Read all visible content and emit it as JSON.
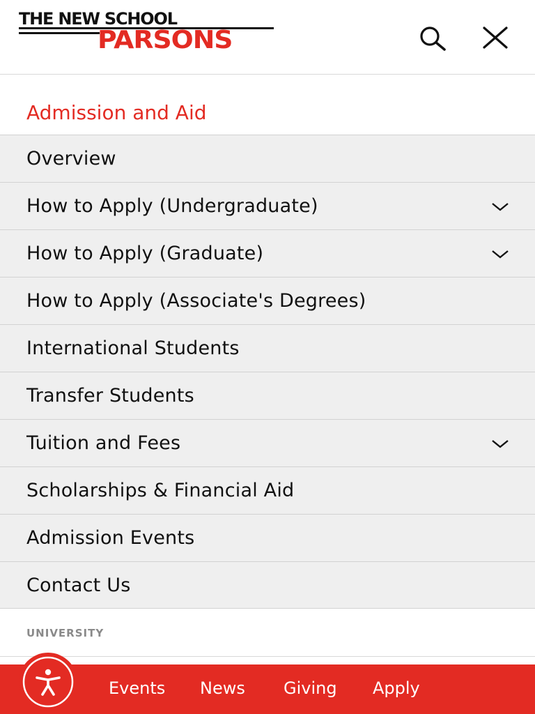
{
  "header": {
    "logo_top": "THE NEW SCHOOL",
    "logo_bottom": "PARSONS",
    "search_icon": "search-icon",
    "close_icon": "close-icon"
  },
  "section": {
    "heading": "Admission and Aid"
  },
  "menu": {
    "items": [
      {
        "label": "Overview",
        "expandable": false
      },
      {
        "label": "How to Apply (Undergraduate)",
        "expandable": true
      },
      {
        "label": "How to Apply (Graduate)",
        "expandable": true
      },
      {
        "label": "How to Apply (Associate's Degrees)",
        "expandable": false
      },
      {
        "label": "International Students",
        "expandable": false
      },
      {
        "label": "Transfer Students",
        "expandable": false
      },
      {
        "label": "Tuition and Fees",
        "expandable": true
      },
      {
        "label": "Scholarships & Financial Aid",
        "expandable": false
      },
      {
        "label": "Admission Events",
        "expandable": false
      },
      {
        "label": "Contact Us",
        "expandable": false
      }
    ]
  },
  "university": {
    "label": "UNIVERSITY"
  },
  "footer": {
    "links": [
      "Events",
      "News",
      "Giving",
      "Apply"
    ],
    "accessibility_icon": "accessibility-icon"
  },
  "colors": {
    "brand_red": "#e32b23",
    "menu_bg": "#efefef",
    "divider": "#d2d2d2"
  }
}
